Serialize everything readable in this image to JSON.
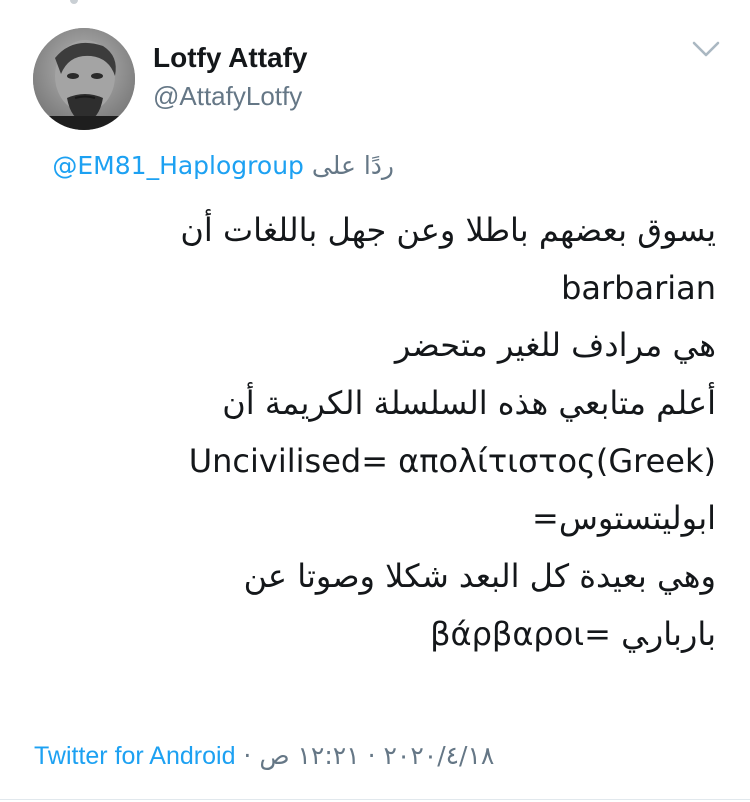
{
  "author": {
    "name": "Lotfy Attafy",
    "handle": "@AttafyLotfy"
  },
  "reply": {
    "prefix": "ردًا على",
    "target": "@EM81_Haplogroup"
  },
  "tweet": {
    "lines": [
      "يسوق بعضهم باطلا وعن جهل باللغات أن",
      "barbarian",
      "هي مرادف للغير متحضر",
      "أعلم متابعي هذه السلسلة الكريمة أن",
      "Uncivilised= απολίτιστος(Greek)",
      "ابوليتستوس=",
      "وهي بعيدة كل البعد شكلا وصوتا عن",
      "باربار‍ي =βάρβαροι"
    ]
  },
  "footer": {
    "source": "Twitter for Android",
    "separator": " · ",
    "date": "٢٠٢٠/٤/١٨",
    "time": "١٢:٢١ ص"
  },
  "icons": {
    "menu": "chevron-down-icon",
    "avatar": "avatar"
  },
  "colors": {
    "link": "#1da1f2",
    "muted": "#657786",
    "text": "#14171a"
  }
}
